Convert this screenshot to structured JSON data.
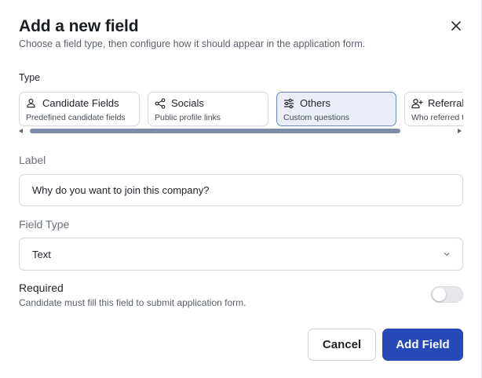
{
  "dialog": {
    "title": "Add a new field",
    "subtitle": "Choose a field type, then configure how it should appear in the application form."
  },
  "type_section": {
    "label": "Type",
    "options": [
      {
        "name": "Candidate Fields",
        "description": "Predefined candidate fields",
        "icon": "person-icon",
        "selected": false
      },
      {
        "name": "Socials",
        "description": "Public profile links",
        "icon": "share-icon",
        "selected": false
      },
      {
        "name": "Others",
        "description": "Custom questions",
        "icon": "sliders-icon",
        "selected": true
      },
      {
        "name": "Referral",
        "description": "Who referred t",
        "icon": "person-add-icon",
        "selected": false
      }
    ]
  },
  "label_field": {
    "label": "Label",
    "value": "Why do you want to join this company?"
  },
  "field_type": {
    "label": "Field Type",
    "value": "Text"
  },
  "required": {
    "title": "Required",
    "description": "Candidate must fill this field to submit application form.",
    "enabled": false
  },
  "actions": {
    "cancel_label": "Cancel",
    "add_label": "Add Field"
  },
  "colors": {
    "primary": "#2749b8",
    "selected_card_bg": "#e9eefa",
    "selected_card_border": "#6f86c4"
  }
}
